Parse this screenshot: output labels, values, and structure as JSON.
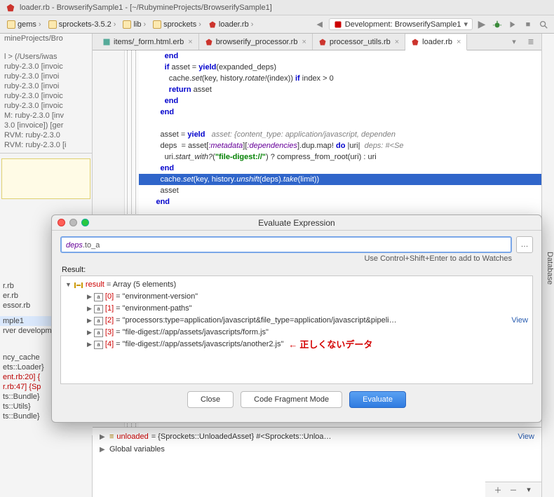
{
  "window": {
    "title": "loader.rb - BrowserifySample1 - [~/RubymineProjects/BrowserifySample1]"
  },
  "breadcrumbs": {
    "items": [
      "gems",
      "sprockets-3.5.2",
      "lib",
      "sprockets",
      "loader.rb"
    ],
    "run_config": "Development: BrowserifySample1"
  },
  "tabs": [
    {
      "label": "items/_form.html.erb"
    },
    {
      "label": "browserify_processor.rb"
    },
    {
      "label": "processor_utils.rb"
    },
    {
      "label": "loader.rb",
      "active": true
    }
  ],
  "sidebar_right": "Database",
  "project": {
    "header": "mineProjects/Bro",
    "rvmPath": "l > (/Users/iwas",
    "lines": [
      "ruby-2.3.0 [invoic",
      " ruby-2.3.0 [invoi",
      " ruby-2.3.0 [invoi",
      " ruby-2.3.0 [invoic",
      "ruby-2.3.0 [invoic",
      "M: ruby-2.3.0 [inv",
      "3.0 [invoice]) [ger",
      "RVM: ruby-2.3.0",
      "RVM: ruby-2.3.0 [i"
    ]
  },
  "code": {
    "l1": "            end",
    "l2a": "            if",
    "l2b": " asset = ",
    "l2c": "yield",
    "l2d": "(expanded_deps)",
    "l3a": "              cache.",
    "l3b": "set",
    "l3c": "(key, history",
    "l3d": ".rotate!",
    "l3e": "(index)) ",
    "l3f": "if",
    "l3g": " index > 0",
    "l4a": "              return",
    "l4b": " asset",
    "l5": "            end",
    "l6": "          end",
    "l8a": "          asset = ",
    "l8b": "yield",
    "l8c": "   asset: {content_type: application/javascript, dependen",
    "l9a": "          deps  = asset[",
    "l9b": ":metadata",
    "l9c": "][",
    "l9d": ":dependencies",
    "l9e": "].dup.map! ",
    "l9f": "do",
    "l9g": " |uri|  ",
    "l9h": "deps: #<Se",
    "l10a": "            uri.",
    "l10b": "start_with?",
    "l10c": "(",
    "l10d": "\"file-digest://\"",
    "l10e": ") ? compress_from_root(uri) : uri",
    "l11": "          end",
    "l12a": "          cache.",
    "l12b": "set",
    "l12c": "(key, history",
    "l12d": ".unshift",
    "l12e": "(deps)",
    "l12f": ".take",
    "l12g": "(limit))",
    "l13": "          asset",
    "l14": "        end"
  },
  "debug": {
    "var1_name": "unloaded",
    "var1_val": " = {Sprockets::UnloadedAsset} #<Sprockets::Unloa…",
    "var2": "Global variables",
    "view": "View"
  },
  "left_bottom": {
    "l1": "r.rb",
    "l2": "er.rb",
    "l3": "essor.rb",
    "sel": "mple1",
    "l4": "rver developm",
    "l5": "ncy_cache",
    "l6": "ets::Loader}",
    "l7": "ent.rb:20] {",
    "l8": "r.rb:47] {Sp",
    "l9": "ts::Bundle}",
    "l10": "ts::Utils}",
    "l11": "ts::Bundle}"
  },
  "dialog": {
    "title": "Evaluate Expression",
    "expr_prefix": "deps",
    "expr_suffix": ".to_a",
    "hint": "Use Control+Shift+Enter to add to Watches",
    "result_label": "Result:",
    "result_name": "result",
    "result_type": " = Array (5 elements)",
    "items": [
      {
        "idx": "[0]",
        "val": " = \"environment-version\""
      },
      {
        "idx": "[1]",
        "val": " = \"environment-paths\""
      },
      {
        "idx": "[2]",
        "val": " = \"processors:type=application/javascript&file_type=application/javascript&pipeli…"
      },
      {
        "idx": "[3]",
        "val": " = \"file-digest://app/assets/javascripts/form.js\""
      },
      {
        "idx": "[4]",
        "val": " = \"file-digest://app/assets/javascripts/another2.js\""
      }
    ],
    "view": "View",
    "annotation_arrow": "←",
    "annotation": " 正しくないデータ",
    "btn_close": "Close",
    "btn_code": "Code Fragment Mode",
    "btn_eval": "Evaluate"
  }
}
